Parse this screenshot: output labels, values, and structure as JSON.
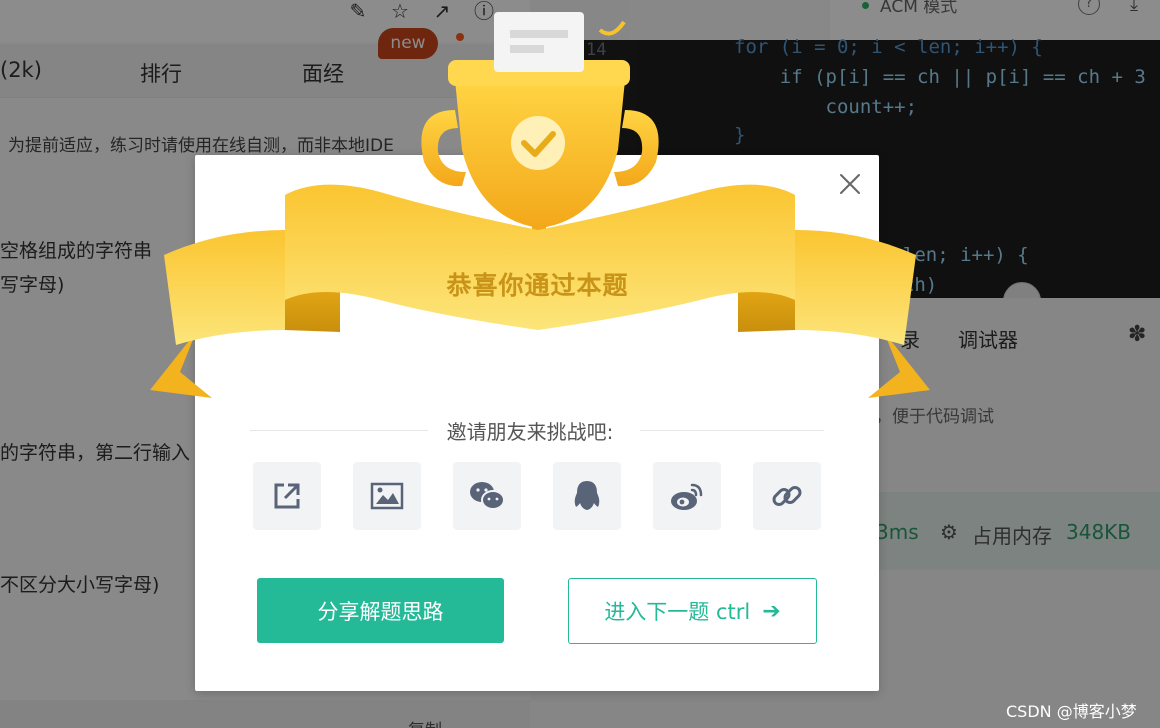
{
  "toolbar": {
    "icons": [
      "edit-icon",
      "star-icon",
      "open-external-icon",
      "alert-icon"
    ]
  },
  "problem_tabs": [
    {
      "label": "(2k)"
    },
    {
      "label": "排行"
    },
    {
      "label": "面经"
    }
  ],
  "badge": {
    "label": "new"
  },
  "problem_text": {
    "note": "为提前适应，练习时请使用在线自测，而非本地IDE",
    "line1": "空格组成的字符串",
    "line2": "写字母)",
    "line3": "的字符串，第二行输入",
    "line4": "不区分大小写字母)",
    "copy": "复制"
  },
  "editor": {
    "mode": "ACM 模式",
    "line_number": "14",
    "code": [
      "for (i = 0; i < len; i++) {",
      "    if (p[i] == ch || p[i] == ch + 3",
      "        count++;",
      "}",
      "; len; i++) {",
      "= ch)"
    ]
  },
  "console": {
    "tabs": [
      "录",
      "调试器"
    ],
    "hint": "，便于代码调试",
    "results": {
      "time": "3ms",
      "memory_label": "占用内存",
      "memory_value": "348KB"
    }
  },
  "modal": {
    "title": "恭喜你通过本题",
    "invite": "邀请朋友来挑战吧:",
    "share_items": [
      {
        "icon": "share-external-icon"
      },
      {
        "icon": "image-icon"
      },
      {
        "icon": "wechat-icon"
      },
      {
        "icon": "qq-icon"
      },
      {
        "icon": "weibo-icon"
      },
      {
        "icon": "link-icon"
      }
    ],
    "primary_button": "分享解题思路",
    "secondary_button": "进入下一题 ctrl",
    "colors": {
      "accent": "#24b997",
      "gold": "#f5b828",
      "title": "#c89318"
    }
  },
  "watermark": "CSDN @博客小梦"
}
